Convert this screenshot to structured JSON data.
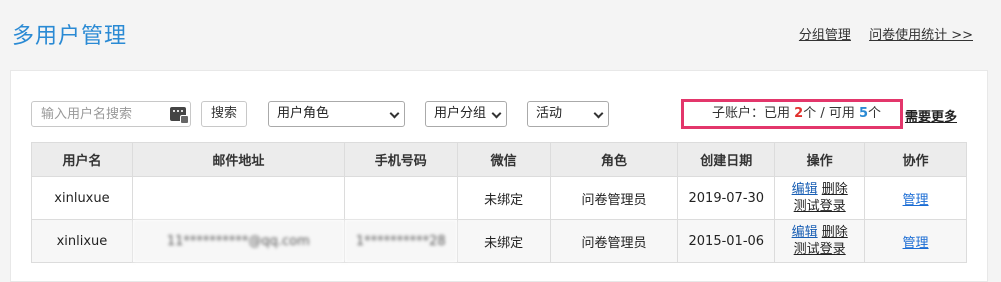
{
  "page": {
    "title": "多用户管理",
    "links": {
      "group_manage": "分组管理",
      "usage_stats": "问卷使用统计 >>"
    }
  },
  "toolbar": {
    "search_placeholder": "输入用户名搜索",
    "search_button": "搜索",
    "role_select": "用户角色",
    "group_select": "用户分组",
    "status_select": "活动",
    "quota": {
      "label": "子账户：",
      "used_prefix": "已用 ",
      "used": "2",
      "used_suffix": "个 / 可用 ",
      "available": "5",
      "available_suffix": "个"
    },
    "need_more": "需要更多"
  },
  "table": {
    "headers": [
      "用户名",
      "邮件地址",
      "手机号码",
      "微信",
      "角色",
      "创建日期",
      "操作",
      "协作"
    ],
    "rows": [
      {
        "username": "xinluxue",
        "email": "",
        "phone": "",
        "wechat": "未绑定",
        "role": "问卷管理员",
        "created": "2019-07-30",
        "edit": "编辑",
        "delete": "删除",
        "test_login": "测试登录",
        "collab": "管理"
      },
      {
        "username": "xinlixue",
        "email": "11**********@qq.com",
        "phone": "1**********28",
        "wechat": "未绑定",
        "role": "问卷管理员",
        "created": "2015-01-06",
        "edit": "编辑",
        "delete": "删除",
        "test_login": "测试登录",
        "collab": "管理"
      }
    ]
  },
  "colors": {
    "accent": "#2a8ad4",
    "highlight_border": "#e3366b",
    "used_count": "#e0302d"
  }
}
